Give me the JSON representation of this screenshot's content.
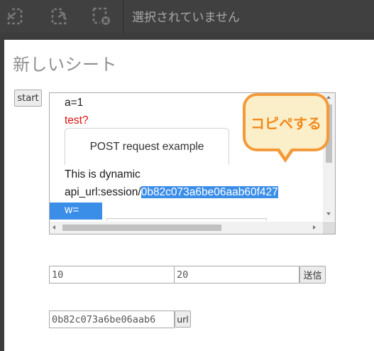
{
  "toolbar": {
    "icons": [
      "undo-icon",
      "redo-icon",
      "clear-selection-icon"
    ],
    "status_text": "選択されていません"
  },
  "sheet": {
    "title": "新しいシート",
    "start_button": "start",
    "panel": {
      "line1": "a=1",
      "line2": "test?",
      "tab_label": "POST request example",
      "line3": "This is dynamic",
      "api_prefix": "api_url:session/",
      "api_session": "0b82c073a6be06aab60f427",
      "line_w": "w="
    },
    "callout": "コピペする",
    "form": {
      "field1_value": "10",
      "field2_value": "20",
      "send_button": "送信",
      "url_field_value": "0b82c073a6be06aab6",
      "url_button": "url"
    }
  },
  "colors": {
    "selection": "#3b8ee8",
    "error_text": "#e01010",
    "callout_border": "#f49a3a",
    "callout_fill": "#fbefc9",
    "callout_text": "#f08a1e"
  }
}
